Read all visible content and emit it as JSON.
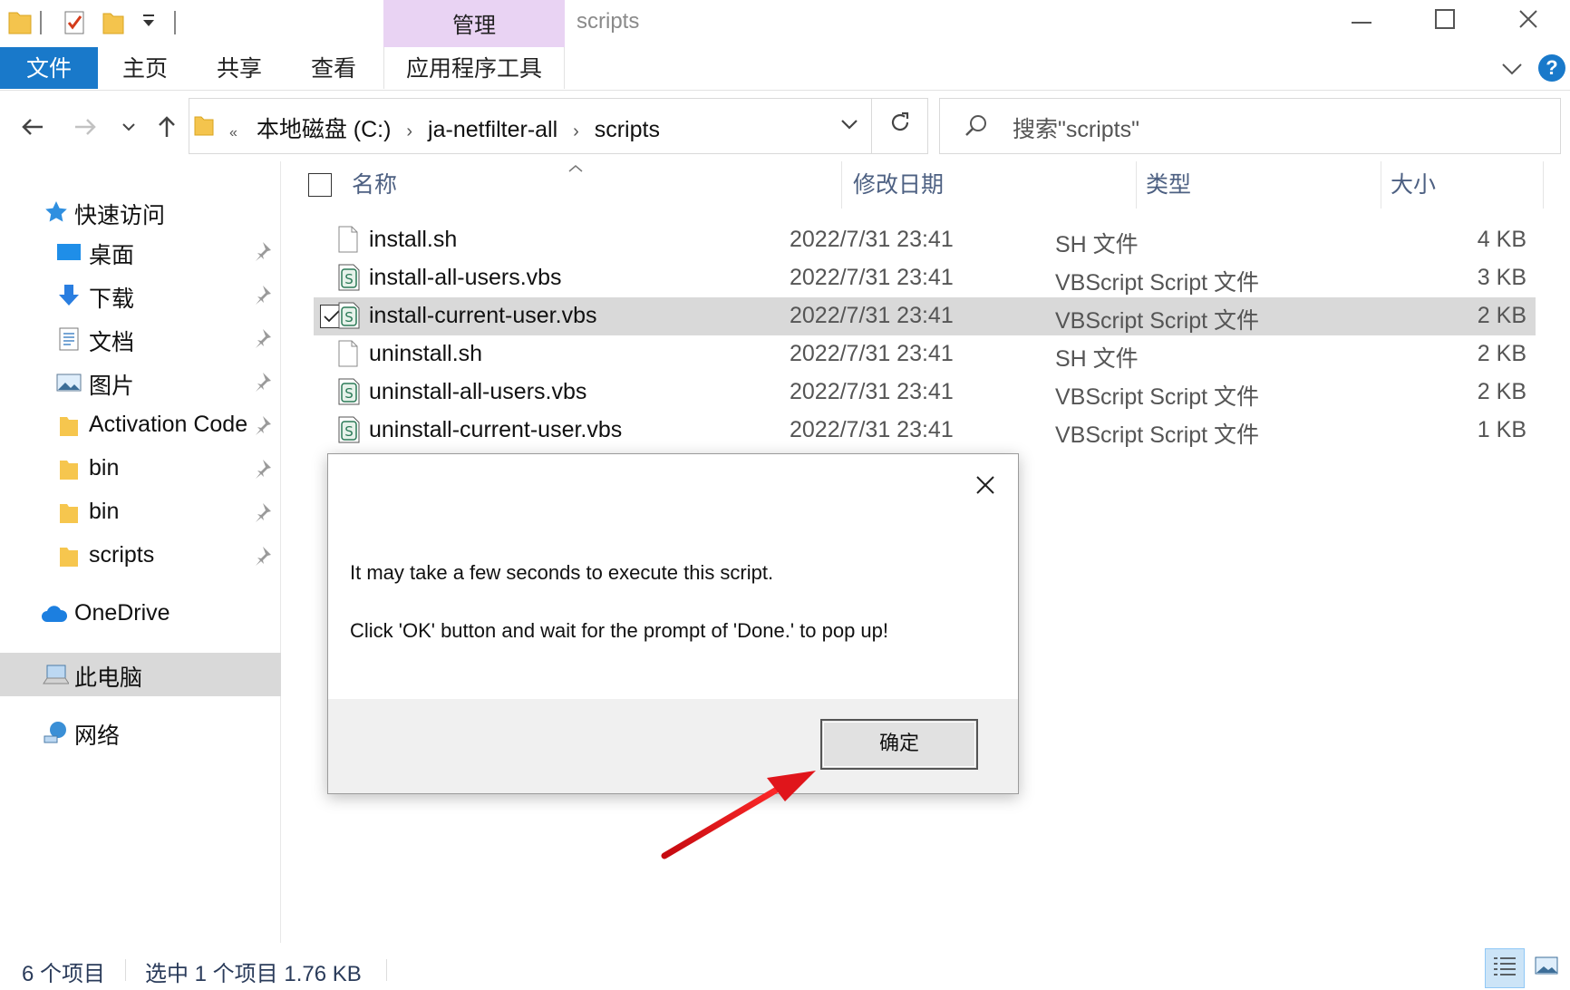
{
  "window": {
    "title": "scripts",
    "manage_tab": "管理"
  },
  "ribbon": {
    "tabs": [
      "文件",
      "主页",
      "共享",
      "查看",
      "应用程序工具"
    ]
  },
  "address": {
    "overflow": "«",
    "crumbs": [
      "本地磁盘 (C:)",
      "ja-netfilter-all",
      "scripts"
    ],
    "search_placeholder": "搜索\"scripts\""
  },
  "navpane": {
    "quick_access": "快速访问",
    "items": [
      {
        "label": "桌面",
        "icon": "desktop-icon",
        "pinned": true
      },
      {
        "label": "下载",
        "icon": "download-icon",
        "pinned": true
      },
      {
        "label": "文档",
        "icon": "document-icon",
        "pinned": true
      },
      {
        "label": "图片",
        "icon": "picture-icon",
        "pinned": true
      },
      {
        "label": "Activation Code",
        "icon": "folder-icon",
        "pinned": true
      },
      {
        "label": "bin",
        "icon": "folder-icon",
        "pinned": true
      },
      {
        "label": "bin",
        "icon": "folder-icon",
        "pinned": true
      },
      {
        "label": "scripts",
        "icon": "folder-icon",
        "pinned": true
      }
    ],
    "onedrive": "OneDrive",
    "this_pc": "此电脑",
    "network": "网络"
  },
  "columns": {
    "name": "名称",
    "date": "修改日期",
    "type": "类型",
    "size": "大小"
  },
  "files": [
    {
      "name": "install.sh",
      "date": "2022/7/31 23:41",
      "type": "SH 文件",
      "size": "4 KB",
      "icon": "blank-file-icon",
      "selected": false
    },
    {
      "name": "install-all-users.vbs",
      "date": "2022/7/31 23:41",
      "type": "VBScript Script 文件",
      "size": "3 KB",
      "icon": "vbscript-file-icon",
      "selected": false
    },
    {
      "name": "install-current-user.vbs",
      "date": "2022/7/31 23:41",
      "type": "VBScript Script 文件",
      "size": "2 KB",
      "icon": "vbscript-file-icon",
      "selected": true
    },
    {
      "name": "uninstall.sh",
      "date": "2022/7/31 23:41",
      "type": "SH 文件",
      "size": "2 KB",
      "icon": "blank-file-icon",
      "selected": false
    },
    {
      "name": "uninstall-all-users.vbs",
      "date": "2022/7/31 23:41",
      "type": "VBScript Script 文件",
      "size": "2 KB",
      "icon": "vbscript-file-icon",
      "selected": false
    },
    {
      "name": "uninstall-current-user.vbs",
      "date": "2022/7/31 23:41",
      "type": "VBScript Script 文件",
      "size": "1 KB",
      "icon": "vbscript-file-icon",
      "selected": false
    }
  ],
  "status": {
    "count": "6 个项目",
    "selection": "选中 1 个项目  1.76 KB"
  },
  "dialog": {
    "line1": "It may take a few seconds to execute this script.",
    "line2": "Click 'OK' button and wait for the prompt of 'Done.' to pop up!",
    "ok_label": "确定"
  },
  "colors": {
    "accent": "#1979ca",
    "manage_tab": "#e9d3f3",
    "selection": "#d9d9d9",
    "arrow": "#e0151b"
  }
}
